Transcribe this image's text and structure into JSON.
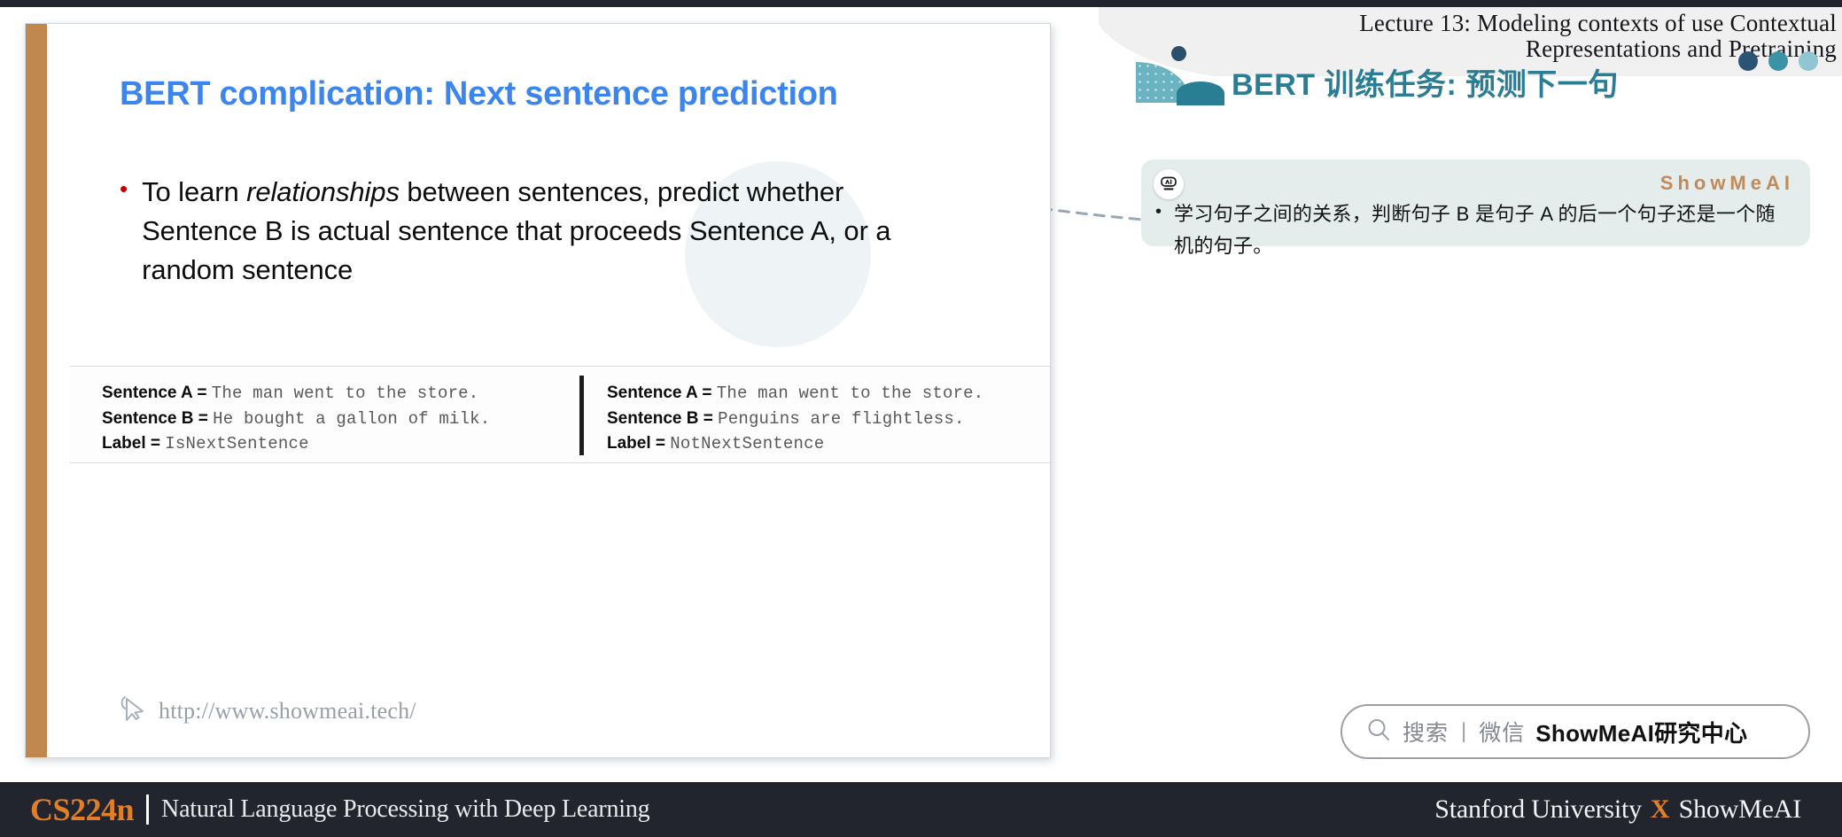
{
  "header": {
    "lecture_title_line1": "Lecture 13:  Modeling contexts of use Contextual",
    "lecture_title_line2": "Representations and Pretraining",
    "cn_heading": "BERT 训练任务: 预测下一句",
    "dot_colors": [
      "#2b5472",
      "#3d93a6",
      "#8fc6d2"
    ]
  },
  "note": {
    "ai_icon": "ai-robot-icon",
    "watermark": "ShowMeAI",
    "bullet": "•",
    "text": "学习句子之间的关系，判断句子 B 是句子 A 的后一个句子还是一个随机的句子。",
    "background": "#e4ecec",
    "watermark_color": "#c08a5a"
  },
  "slide": {
    "title": "BERT complication: Next sentence prediction",
    "title_color": "#3c85ef",
    "bullet_marker": "•",
    "bullet_text_part1": "To learn ",
    "bullet_text_italic": "relationships",
    "bullet_text_part2": " between sentences, predict whether Sentence B is actual sentence that proceeds Sentence A, or a random sentence",
    "examples": [
      {
        "rows": [
          {
            "key": "Sentence A",
            "eq": " = ",
            "value": "The man went to the store."
          },
          {
            "key": "Sentence B",
            "eq": " = ",
            "value": "He bought a gallon of milk."
          },
          {
            "key": "Label",
            "eq": " = ",
            "value": "IsNextSentence"
          }
        ]
      },
      {
        "rows": [
          {
            "key": "Sentence A",
            "eq": " = ",
            "value": "The man went to the store."
          },
          {
            "key": "Sentence B",
            "eq": " = ",
            "value": "Penguins are flightless."
          },
          {
            "key": "Label",
            "eq": " = ",
            "value": "NotNextSentence"
          }
        ]
      }
    ],
    "url": "http://www.showmeai.tech/",
    "url_icon": "cursor-pointer-icon",
    "left_bar_color": "#c2874d"
  },
  "search_pill": {
    "icon": "search-icon",
    "label": "搜索",
    "separator": "|",
    "label2": "微信",
    "strong": "ShowMeAI研究中心"
  },
  "bottom_bar": {
    "course_code": "CS224n",
    "course_name": "Natural Language Processing with Deep Learning",
    "right_left": "Stanford University",
    "right_x": "X",
    "right_right": "ShowMeAI",
    "bg": "#22252e",
    "accent": "#e07f28"
  }
}
